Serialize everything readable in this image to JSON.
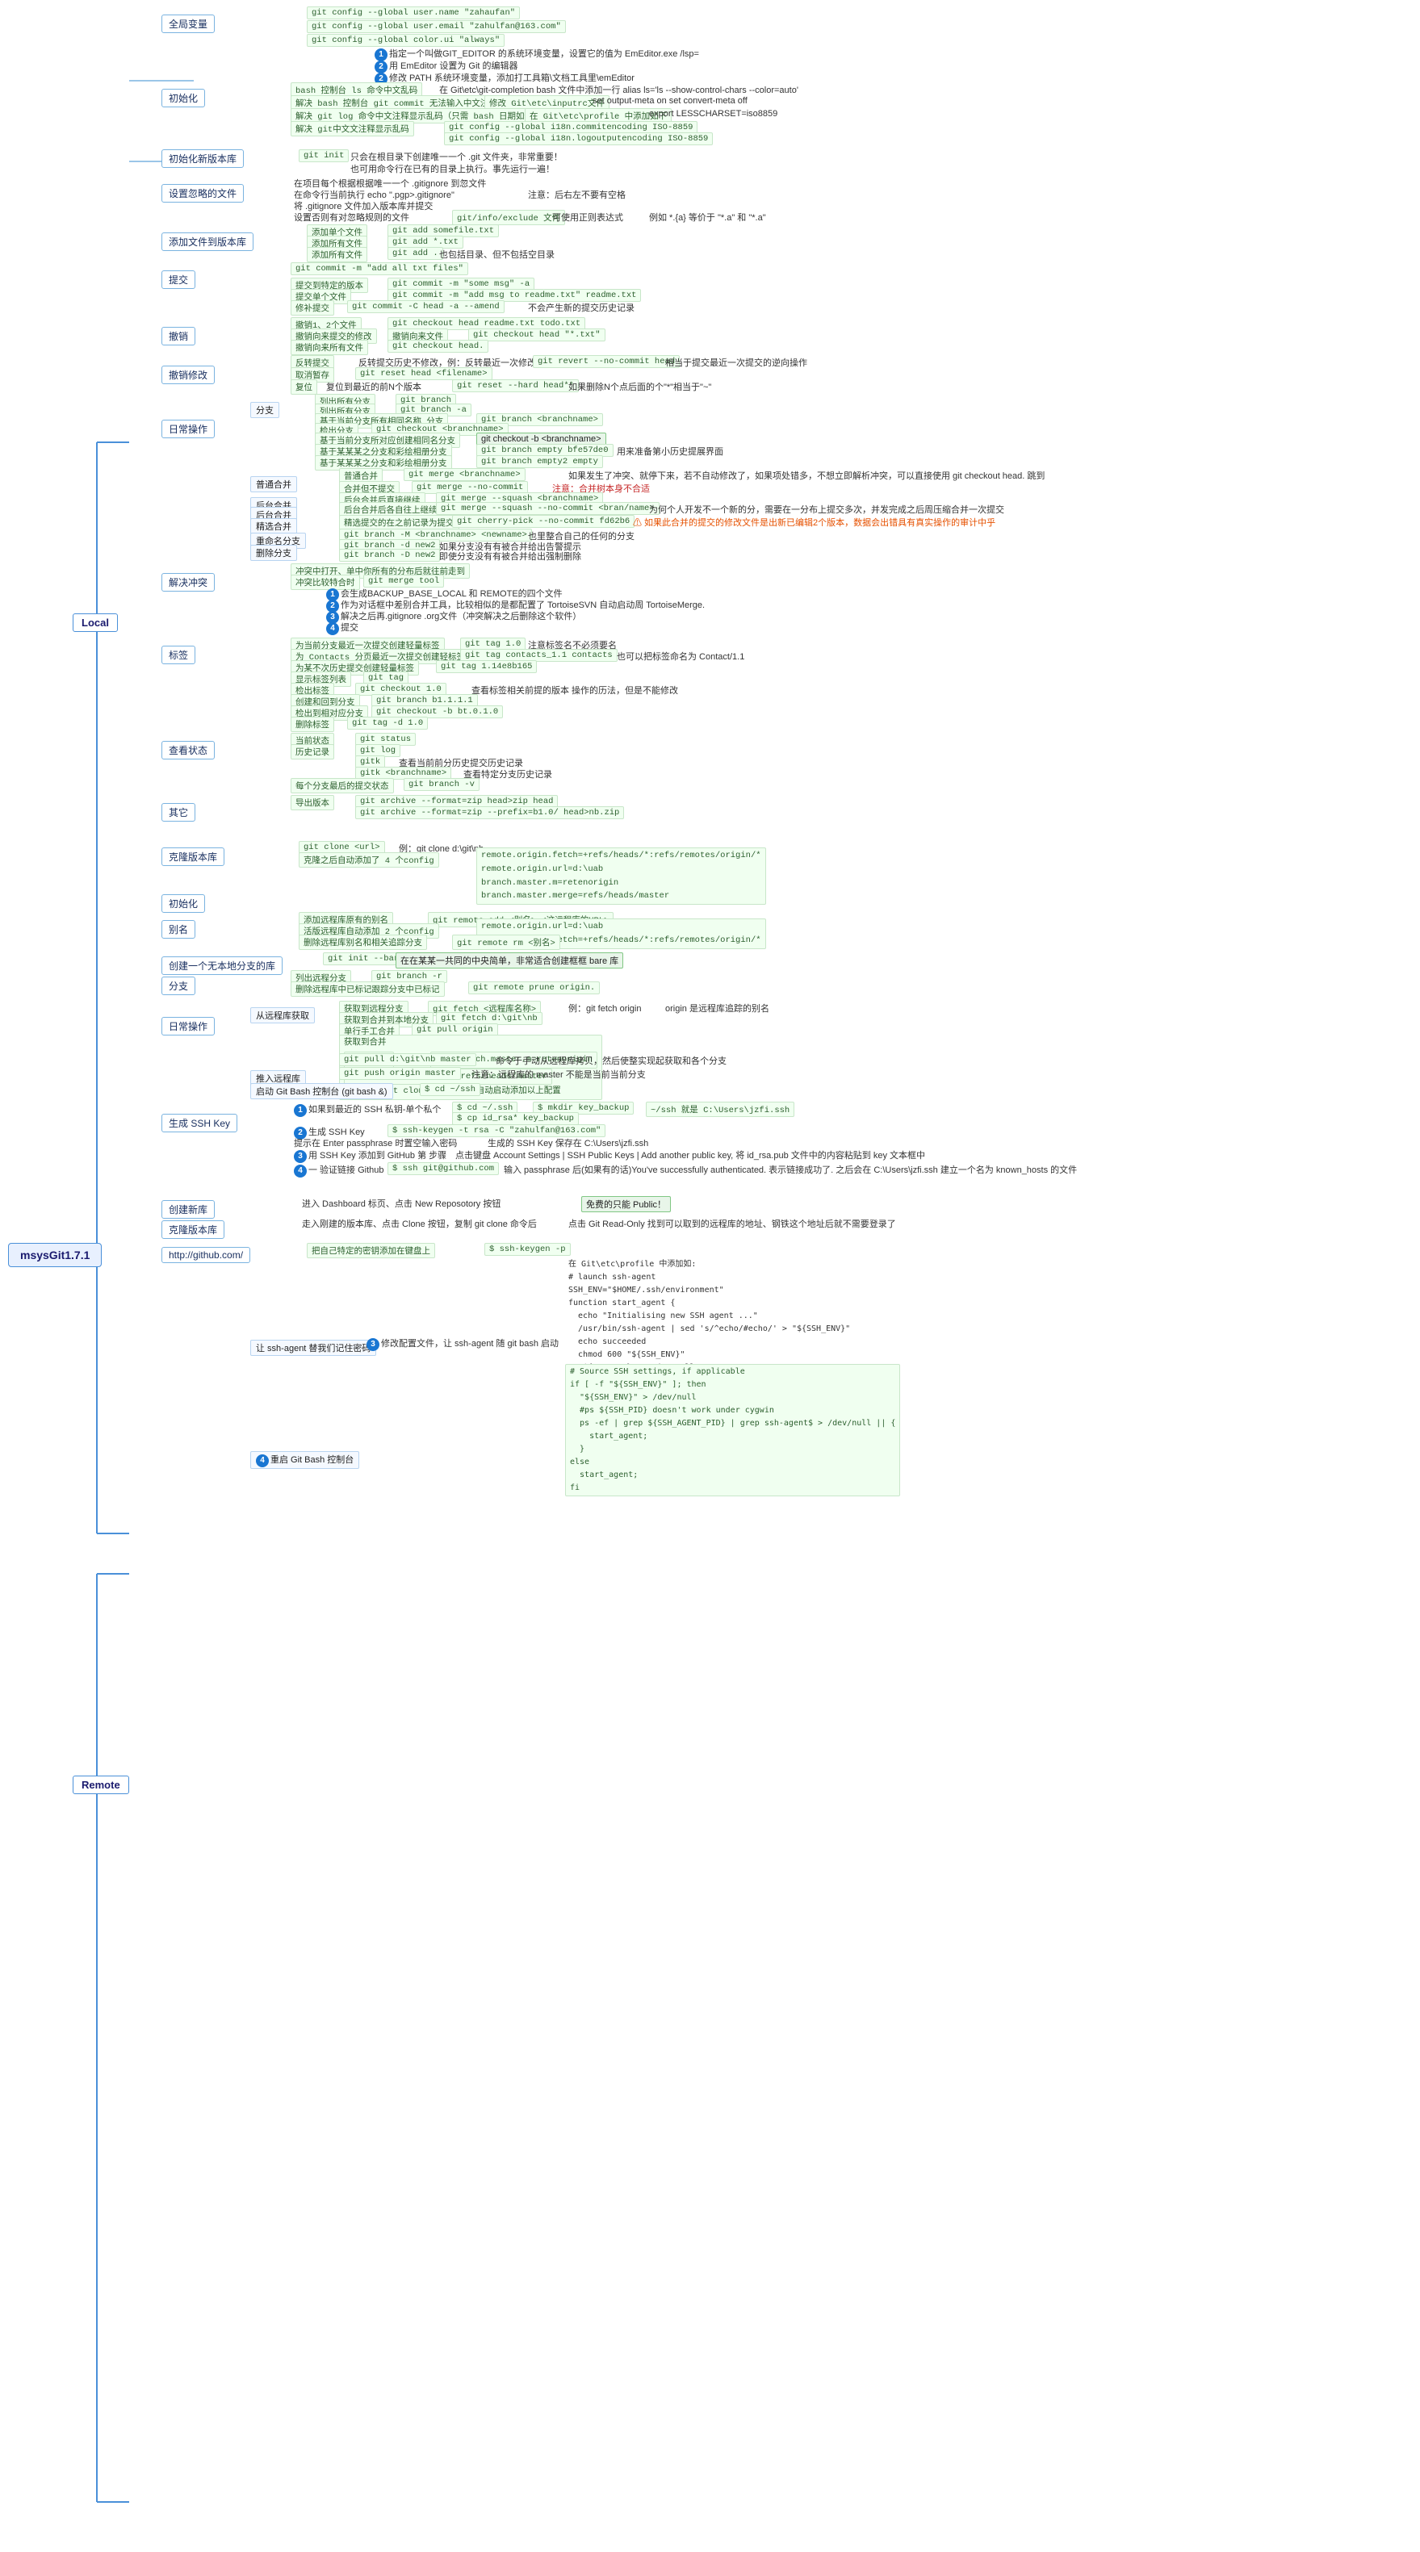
{
  "title": "msysGit1.7.1",
  "sections": {
    "local": "Local",
    "remote": "Remote"
  },
  "categories": {
    "init": "初始化",
    "globalVar": "全局变量",
    "initVersion": "初始化新版本库",
    "configIgnore": "设置忽略的文件",
    "addFiles": "添加文件到版本库",
    "commit": "提交",
    "undoModify": "撤销修改",
    "dailyOps": "日常操作",
    "branch": "分支",
    "tags": "标签",
    "checkStatus": "查看状态",
    "other": "其它",
    "resolveConflict": "解决冲突",
    "remoteInit": "初始化",
    "alias": "别名",
    "createLocalBranch": "创建一个无本地分支的库",
    "remoteBranch": "分支",
    "fetchFromRemote": "从远程库获取",
    "pushToRemote": "推入远程库",
    "generateSSH": "生成 SSH Key",
    "github": "http://github.com/",
    "createNewRepo": "创建新库",
    "cloneRepo": "克隆版本库"
  }
}
